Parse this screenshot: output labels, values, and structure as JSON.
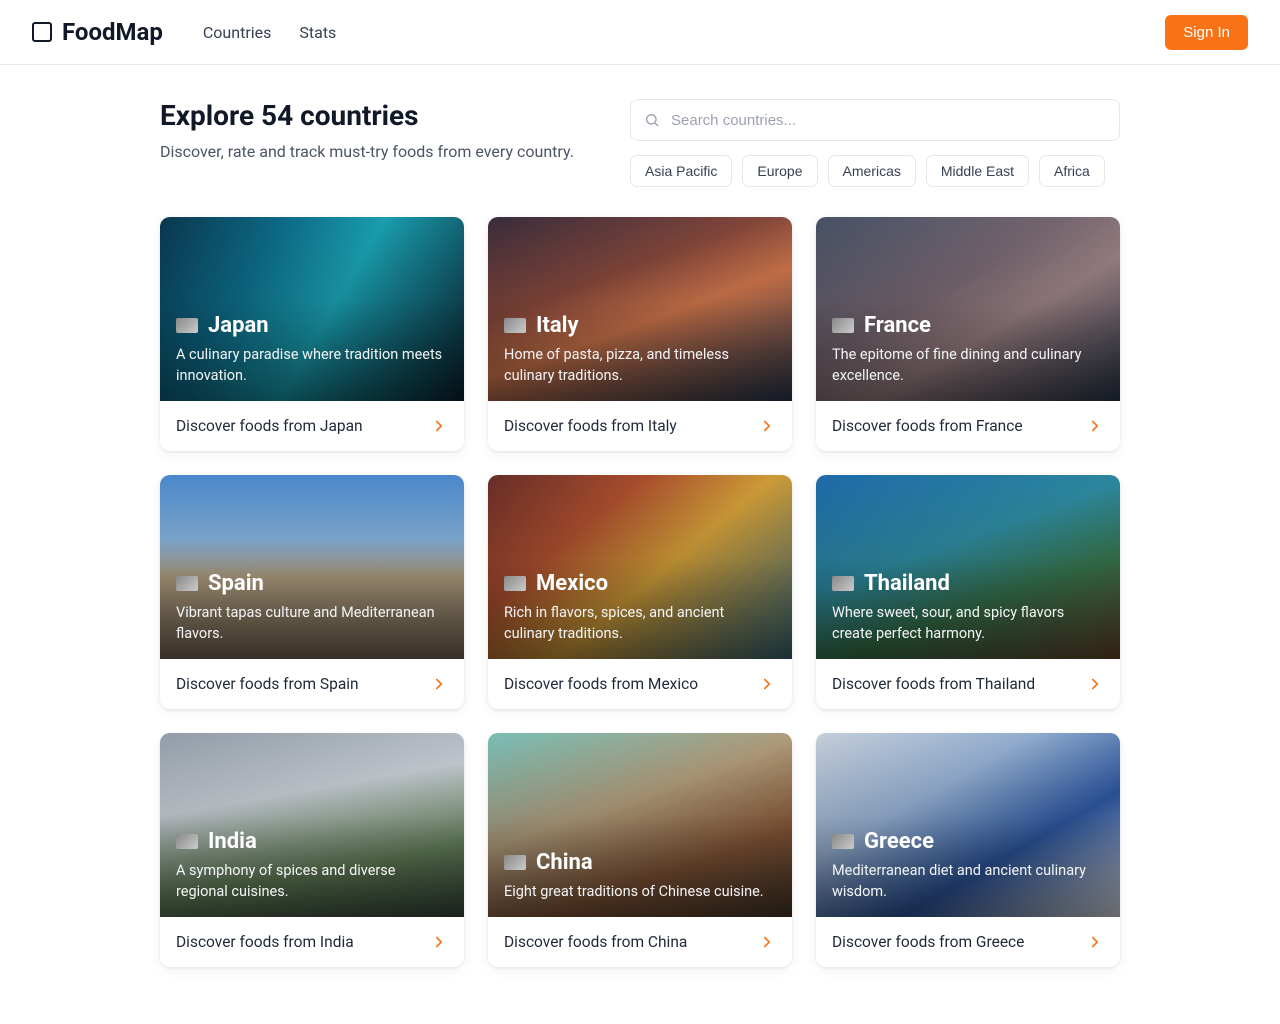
{
  "header": {
    "brand": "FoodMap",
    "nav": [
      "Countries",
      "Stats"
    ],
    "signin": "Sign In"
  },
  "hero": {
    "title": "Explore 54 countries",
    "subtitle": "Discover, rate and track must-try foods from every country."
  },
  "search": {
    "placeholder": "Search countries..."
  },
  "filters": [
    "Asia Pacific",
    "Europe",
    "Americas",
    "Middle East",
    "Africa"
  ],
  "countries": [
    {
      "name": "Japan",
      "desc": "A culinary paradise where tradition meets innovation.",
      "cta": "Discover foods from Japan",
      "bg": "linear-gradient(120deg,#0b3a52 0%,#0d6e8c 30%,#1ba6b8 55%,#0a2230 100%)"
    },
    {
      "name": "Italy",
      "desc": "Home of pasta, pizza, and timeless culinary traditions.",
      "cta": "Discover foods from Italy",
      "bg": "linear-gradient(160deg,#3b2e3f 0%,#8a4a3d 35%,#d97b4f 55%,#2a3a52 100%)"
    },
    {
      "name": "France",
      "desc": "The epitome of fine dining and culinary excellence.",
      "cta": "Discover foods from France",
      "bg": "linear-gradient(150deg,#4a556b 0%,#7a6a74 40%,#a2878a 60%,#2f3a4c 100%)"
    },
    {
      "name": "Spain",
      "desc": "Vibrant tapas culture and Mediterranean flavors.",
      "cta": "Discover foods from Spain",
      "bg": "linear-gradient(180deg,#4f8fd6 0%,#8abae6 35%,#bca98a 55%,#7a6a55 100%)"
    },
    {
      "name": "Mexico",
      "desc": "Rich in flavors, spices, and ancient culinary traditions.",
      "cta": "Discover foods from Mexico",
      "bg": "linear-gradient(140deg,#6b2f2a 0%,#b0502f 30%,#d9a43a 55%,#3a6b7a 100%)"
    },
    {
      "name": "Thailand",
      "desc": "Where sweet, sour, and spicy flavors create perfect harmony.",
      "cta": "Discover foods from Thailand",
      "bg": "linear-gradient(160deg,#1f6fb2 0%,#2f8fa6 40%,#3a7a4f 65%,#6b4a2f 100%)"
    },
    {
      "name": "India",
      "desc": "A symphony of spices and diverse regional cuisines.",
      "cta": "Discover foods from India",
      "bg": "linear-gradient(170deg,#9aa4b0 0%,#cfd6dd 35%,#6b8a5f 70%,#3a4a3f 100%)"
    },
    {
      "name": "China",
      "desc": "Eight great traditions of Chinese cuisine.",
      "cta": "Discover foods from China",
      "bg": "linear-gradient(160deg,#7fc8c0 0%,#b8a280 40%,#8a5a3a 70%,#4a3a2a 100%)"
    },
    {
      "name": "Greece",
      "desc": "Mediterranean diet and ancient culinary wisdom.",
      "cta": "Discover foods from Greece",
      "bg": "linear-gradient(150deg,#cfd9e6 0%,#9ab6d9 35%,#2f5aa6 65%,#e6e9ee 100%)"
    }
  ]
}
